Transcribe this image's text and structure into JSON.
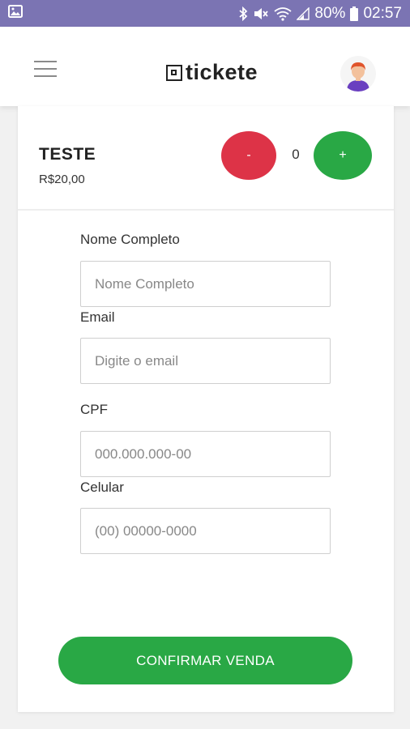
{
  "status_bar": {
    "battery_percent": "80%",
    "time": "02:57",
    "background": "#7b74b3"
  },
  "header": {
    "logo_text": "tickete"
  },
  "product": {
    "name": "TESTE",
    "price": "R$20,00",
    "decrement_label": "-",
    "quantity": "0",
    "increment_label": "+"
  },
  "form": {
    "fields": [
      {
        "label": "Nome Completo",
        "placeholder": "Nome Completo",
        "value": ""
      },
      {
        "label": "Email",
        "placeholder": "Digite o email",
        "value": ""
      },
      {
        "label": "CPF",
        "placeholder": "000.000.000-00",
        "value": ""
      },
      {
        "label": "Celular",
        "placeholder": "(00) 00000-0000",
        "value": ""
      }
    ],
    "confirm_label": "CONFIRMAR VENDA"
  },
  "colors": {
    "accent_green": "#29a845",
    "decrement_red": "#dd3347"
  }
}
